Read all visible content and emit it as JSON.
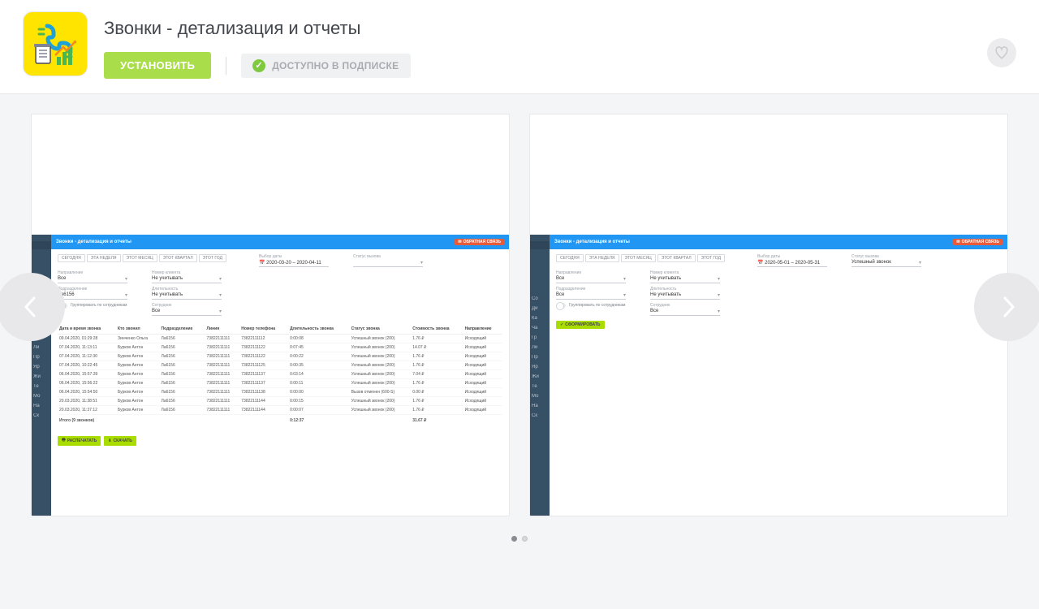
{
  "header": {
    "title": "Звонки - детализация и отчеты",
    "install": "УСТАНОВИТЬ",
    "subscription": "ДОСТУПНО В ПОДПИСКЕ"
  },
  "mini": {
    "title": "Звонки - детализация и отчеты",
    "feedback": "ОБРАТНАЯ СВЯЗЬ",
    "pills": [
      "СЕГОДНЯ",
      "ЭТА НЕДЕЛЯ",
      "ЭТОТ МЕСЯЦ",
      "ЭТОТ КВАРТАЛ",
      "ЭТОТ ГОД"
    ],
    "field_labels": {
      "date_range": "Выбор даты",
      "status": "Статус вызова",
      "direction": "Направление",
      "client": "Номер клиента",
      "dept": "Подразделение",
      "duration": "Длительность",
      "employee": "Сотрудник"
    },
    "common_values": {
      "all": "Все",
      "ignore": "Не учитывать"
    },
    "group_toggle": "Группировать по сотрудникам",
    "btn_print": "РАСПЕЧАТАТЬ",
    "btn_download": "СКАЧАТЬ",
    "btn_generate": "СФОРМИРОВАТЬ",
    "side_items": [
      "",
      "",
      "",
      "Со",
      "Ди",
      "Ка",
      "Ча",
      "Гр",
      "Ли",
      "Пр",
      "Яр",
      "Жи",
      "Те",
      "Мо",
      "На",
      "Ск"
    ]
  },
  "s1": {
    "date_range": "2020-03-20 – 2020-04-11",
    "status": "",
    "dept": "Ла6156",
    "table_headers": [
      "Дата и время звонка",
      "Кто звонил",
      "Подразделение",
      "Линия",
      "Номер телефона",
      "Длительность звонка",
      "Статус звонка",
      "Стоимость звонка",
      "Направление"
    ],
    "rows": [
      [
        "09.04.2020, 01:29:28",
        "Зинченко Ольга",
        "Ла6156",
        "73822111111",
        "73822111112",
        "0:00:08",
        "Успешный звонок (200)",
        "1.76 ₽",
        "Исходящий"
      ],
      [
        "07.04.2020, 11:13:11",
        "Бурков Антон",
        "Ла6156",
        "73822111111",
        "73822111122",
        "0:07:45",
        "Успешный звонок (200)",
        "14.07 ₽",
        "Исходящий"
      ],
      [
        "07.04.2020, 11:12:30",
        "Бурков Антон",
        "Ла6156",
        "73822111111",
        "73822111122",
        "0:00:22",
        "Успешный звонок (200)",
        "1.76 ₽",
        "Исходящий"
      ],
      [
        "07.04.2020, 10:22:45",
        "Бурков Антон",
        "Ла6156",
        "73822111111",
        "73822111125",
        "0:00:35",
        "Успешный звонок (200)",
        "1.76 ₽",
        "Исходящий"
      ],
      [
        "06.04.2020, 15:57:39",
        "Бурков Антон",
        "Ла6156",
        "73822111111",
        "73822111137",
        "0:03:14",
        "Успешный звонок (200)",
        "7.04 ₽",
        "Исходящий"
      ],
      [
        "06.04.2020, 15:56:22",
        "Бурков Антон",
        "Ла6156",
        "73822111111",
        "73822111137",
        "0:00:11",
        "Успешный звонок (200)",
        "1.76 ₽",
        "Исходящий"
      ],
      [
        "06.04.2020, 15:54:50",
        "Бурков Антон",
        "Ла6156",
        "73822111111",
        "73822111138",
        "0:00:00",
        "Вызов отменен (600-S)",
        "0.00 ₽",
        "Исходящий"
      ],
      [
        "20.03.2020, 11:38:51",
        "Бурков Антон",
        "Ла6156",
        "73822111111",
        "73822111144",
        "0:00:15",
        "Успешный звонок (200)",
        "1.76 ₽",
        "Исходящий"
      ],
      [
        "20.03.2020, 11:37:12",
        "Бурков Антон",
        "Ла6156",
        "73822111111",
        "73822111144",
        "0:00:07",
        "Успешный звонок (200)",
        "1.76 ₽",
        "Исходящий"
      ]
    ],
    "total_label": "Итого (9 звонков)",
    "total_duration": "0:12:37",
    "total_cost": "31.67 ₽"
  },
  "s2": {
    "date_range": "2020-05-01 – 2020-05-31",
    "status": "Успешный звонок",
    "dept": "Все"
  }
}
